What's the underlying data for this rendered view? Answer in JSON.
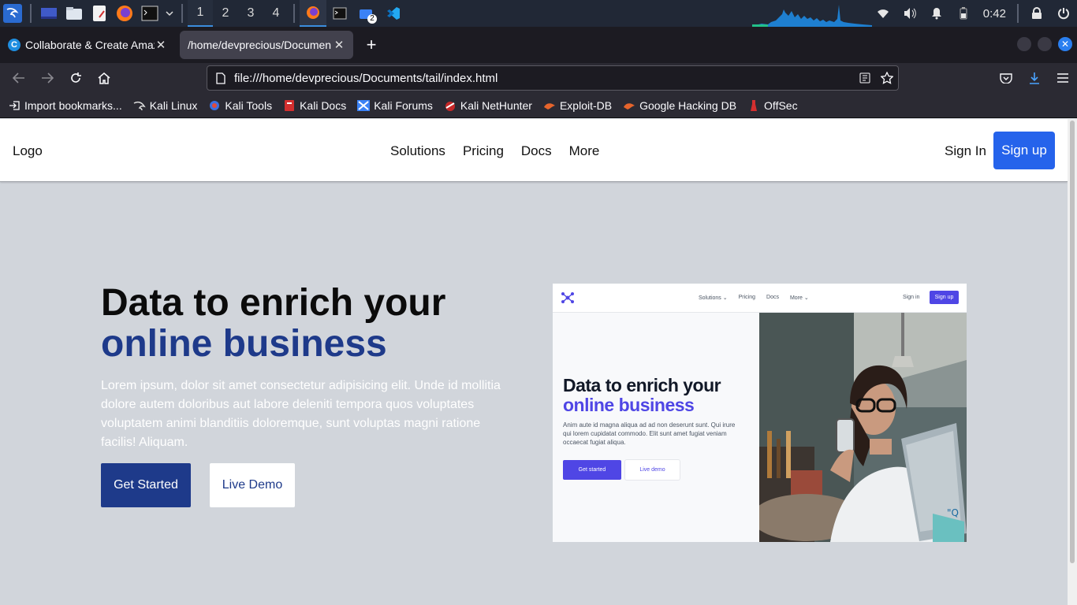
{
  "taskbar": {
    "workspaces": [
      "1",
      "2",
      "3",
      "4"
    ],
    "files_badge": "2",
    "clock": "0:42"
  },
  "browser": {
    "tabs": [
      {
        "title": "Collaborate & Create Amaz"
      },
      {
        "title": "/home/devprecious/Documen"
      }
    ],
    "url": "file:///home/devprecious/Documents/tail/index.html",
    "bookmarks": [
      "Import bookmarks...",
      "Kali Linux",
      "Kali Tools",
      "Kali Docs",
      "Kali Forums",
      "Kali NetHunter",
      "Exploit-DB",
      "Google Hacking DB",
      "OffSec"
    ]
  },
  "site": {
    "logo": "Logo",
    "menu": [
      "Solutions",
      "Pricing",
      "Docs",
      "More"
    ],
    "signin": "Sign In",
    "signup": "Sign up"
  },
  "hero": {
    "title_line1": "Data to enrich your",
    "title_line2": "online business",
    "paragraph": "Lorem ipsum, dolor sit amet consectetur adipisicing elit. Unde id mollitia dolore autem doloribus aut labore deleniti tempora quos voluptates voluptatem animi blanditiis doloremque, sunt voluptas magni ratione facilis! Aliquam.",
    "primary_button": "Get Started",
    "secondary_button": "Live Demo"
  },
  "mockup": {
    "menu": [
      "Solutions ⌄",
      "Pricing",
      "Docs",
      "More ⌄"
    ],
    "signin": "Sign in",
    "signup": "Sign up",
    "title_line1": "Data to enrich your",
    "title_line2": "online business",
    "paragraph": "Anim aute id magna aliqua ad ad non deserunt sunt. Qui irure qui lorem cupidatat commodo. Elit sunt amet fugiat veniam occaecat fugiat aliqua.",
    "primary_button": "Get started",
    "secondary_button": "Live demo"
  },
  "colors": {
    "accent": "#1e3a8a",
    "signup": "#2563eb",
    "page_bg": "#d1d5db",
    "mock_accent": "#4f46e5"
  }
}
